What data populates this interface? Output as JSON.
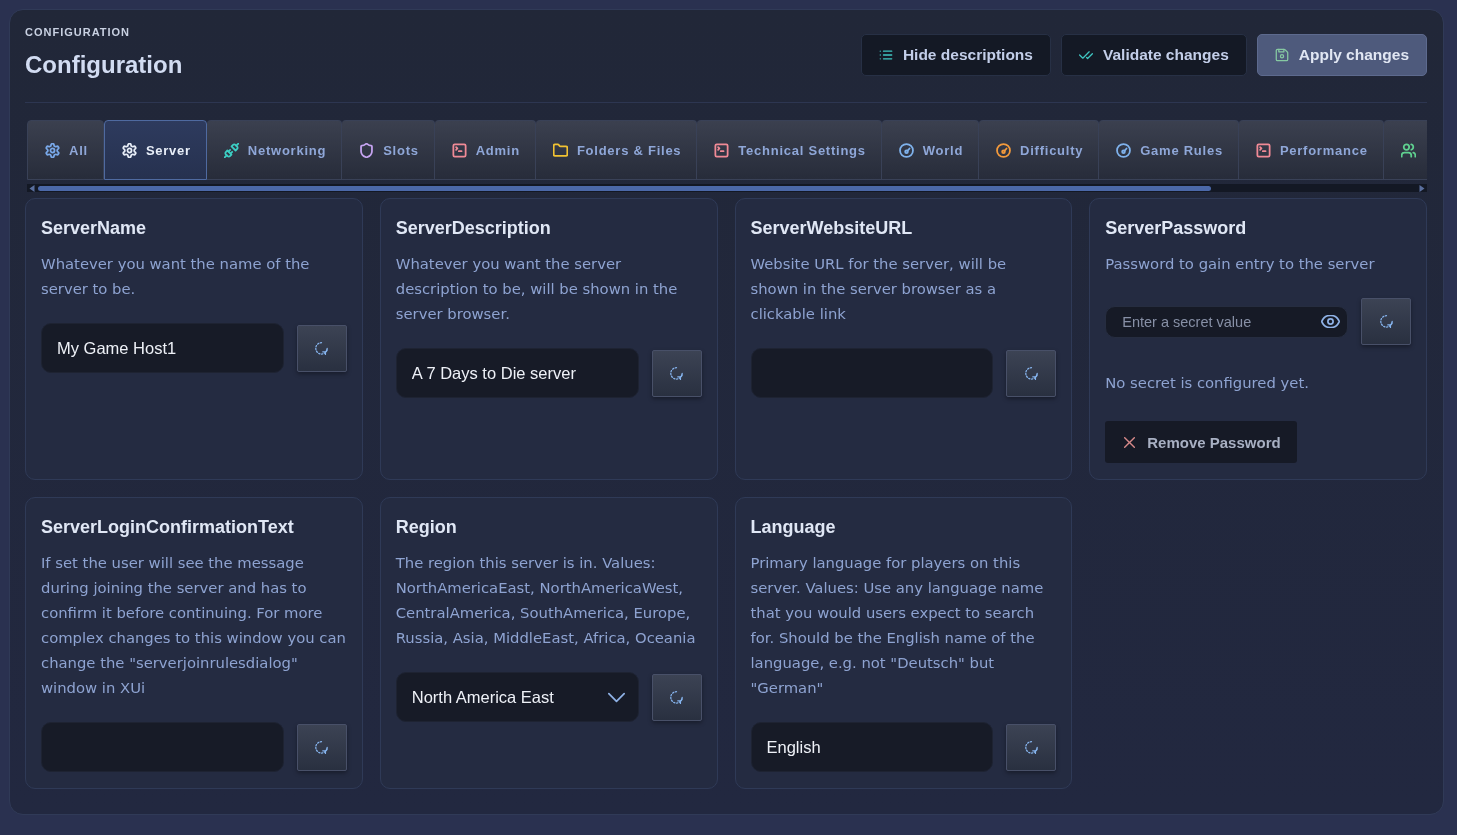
{
  "header": {
    "eyebrow": "CONFIGURATION",
    "title": "Configuration"
  },
  "actions": [
    {
      "label": "Hide descriptions",
      "kind": "secondary"
    },
    {
      "label": "Validate changes",
      "kind": "secondary"
    },
    {
      "label": "Apply changes",
      "kind": "primary"
    }
  ],
  "tabs": [
    {
      "label": "All",
      "selected": false,
      "color": "#79a9ea"
    },
    {
      "label": "Server",
      "selected": true,
      "color": "#e8eef8"
    },
    {
      "label": "Networking",
      "selected": false,
      "color": "#3ccfc4"
    },
    {
      "label": "Slots",
      "selected": false,
      "color": "#c5a3f0"
    },
    {
      "label": "Admin",
      "selected": false,
      "color": "#f08a96"
    },
    {
      "label": "Folders & Files",
      "selected": false,
      "color": "#f1c232"
    },
    {
      "label": "Technical Settings",
      "selected": false,
      "color": "#f08a96"
    },
    {
      "label": "World",
      "selected": false,
      "color": "#7fb2ec"
    },
    {
      "label": "Difficulty",
      "selected": false,
      "color": "#f39a3c"
    },
    {
      "label": "Game Rules",
      "selected": false,
      "color": "#7fb2ec"
    },
    {
      "label": "Performance",
      "selected": false,
      "color": "#f08a96"
    },
    {
      "selected": false,
      "color": "#5fd08f"
    }
  ],
  "settings": [
    {
      "kind": "text",
      "name": "ServerName",
      "description": "Whatever you want the name of the server to be.",
      "value": "My Game Host1"
    },
    {
      "kind": "text",
      "name": "ServerDescription",
      "description": "Whatever you want the server description to be, will be shown in the server browser.",
      "value": "A 7 Days to Die server"
    },
    {
      "kind": "text",
      "name": "ServerWebsiteURL",
      "description": "Website URL for the server, will be shown in the server browser as a clickable link"
    },
    {
      "kind": "secret",
      "name": "ServerPassword",
      "description": "Password to gain entry to the server",
      "placeholder": "Enter a secret value",
      "status": "No secret is configured yet.",
      "remove_button": "Remove Password"
    },
    {
      "kind": "text",
      "name": "ServerLoginConfirmationText",
      "description": "If set the user will see the message during joining the server and has to confirm it before continuing. For more complex changes to this window you can change the \"serverjoinrulesdialog\" window in XUi"
    },
    {
      "kind": "select",
      "name": "Region",
      "description": "The region this server is in. Values: NorthAmericaEast, NorthAmericaWest, CentralAmerica, SouthAmerica, Europe, Russia, Asia, MiddleEast, Africa, Oceania",
      "value": "North America East"
    },
    {
      "kind": "text",
      "name": "Language",
      "description": "Primary language for players on this server. Values: Use any language name that you would users expect to search for. Should be the English name of the language, e.g. not \"Deutsch\" but \"German\"",
      "value": "English"
    }
  ]
}
